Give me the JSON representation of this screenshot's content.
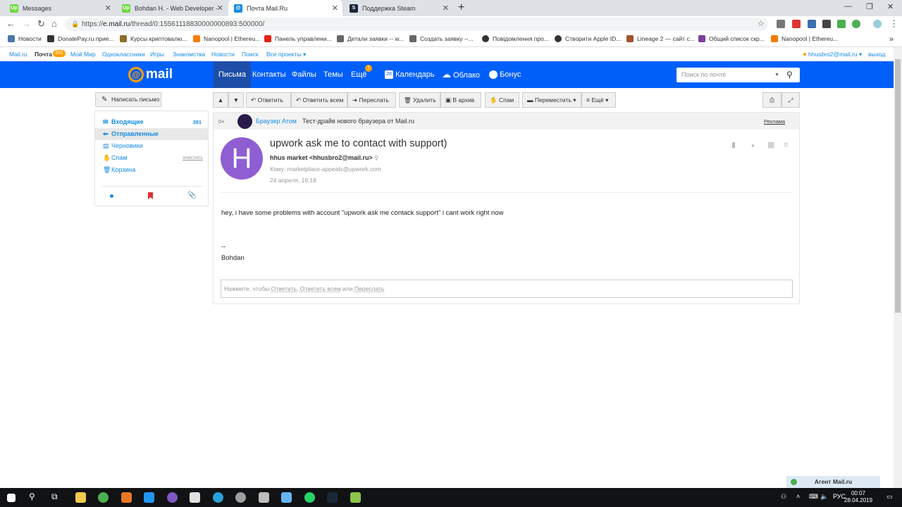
{
  "browser": {
    "tabs": [
      {
        "title": "Messages",
        "favicon": "upwork-icon",
        "color": "#6fda44"
      },
      {
        "title": "Bohdan H. - Web Developer - Up",
        "favicon": "upwork-icon",
        "color": "#6fda44"
      },
      {
        "title": "Почта Mail.Ru",
        "favicon": "mailru-icon",
        "color": "#168de2"
      },
      {
        "title": "Поддержка Steam",
        "favicon": "steam-icon",
        "color": "#1b2838"
      }
    ],
    "new_tab": "+",
    "url_prefix": "https://",
    "url_host": "e.mail.ru",
    "url_path": "/thread/0:15561118830000000893:500000/",
    "bookmarks": [
      {
        "label": "Новости",
        "color": "#4a76a8"
      },
      {
        "label": "DonatePay.ru прие...",
        "color": "#333"
      },
      {
        "label": "Курсы криптовалю...",
        "color": "#8b6d2d"
      },
      {
        "label": "Nanopool | Ethereu...",
        "color": "#f57c00"
      },
      {
        "label": "Панель управлени...",
        "color": "#e62117"
      },
      {
        "label": "Детали заявки -- w...",
        "color": "#555"
      },
      {
        "label": "Создать заявку --...",
        "color": "#555"
      },
      {
        "label": "Повідомлення про...",
        "color": "#333"
      },
      {
        "label": "Створити Apple ID...",
        "color": "#333"
      },
      {
        "label": "Lineage 2 — сайт с...",
        "color": "#a0522d"
      },
      {
        "label": "Общий список скр...",
        "color": "#7b3fa0"
      },
      {
        "label": "Nanopool | Ethereu...",
        "color": "#f57c00"
      }
    ]
  },
  "portal": {
    "links": [
      "Mail.ru",
      "Почта",
      "Мой Мир",
      "Одноклассники",
      "Игры",
      "Знакомства",
      "Новости",
      "Поиск",
      "Все проекты ▾"
    ],
    "pochta_count": "391",
    "user": "hhusbro2@mail.ru ▾",
    "logout": "выход"
  },
  "header": {
    "logo_text": "mail",
    "nav": [
      "Письма",
      "Контакты",
      "Файлы",
      "Темы",
      "Ещё"
    ],
    "more_badge": "1",
    "services": [
      "Календарь",
      "Облако",
      "Бонус"
    ],
    "calendar_day": "28",
    "search_placeholder": "Поиск по почте"
  },
  "sidebar": {
    "compose": "Написать письмо",
    "folders": [
      {
        "label": "Входящие",
        "count": "391"
      },
      {
        "label": "Отправленные"
      },
      {
        "label": "Черновики"
      },
      {
        "label": "Спам",
        "action": "очистить"
      },
      {
        "label": "Корзина"
      }
    ]
  },
  "toolbar": {
    "reply": "Ответить",
    "reply_all": "Ответить всем",
    "forward": "Переслать",
    "delete": "Удалить",
    "archive": "В архив",
    "spam": "Спам",
    "move": "Переместить ▾",
    "more": "≡ Ещё ▾"
  },
  "ad": {
    "age": "0+",
    "brand": "Браузер Атом",
    "text": "Тест-драйв нового браузера от Mail.ru",
    "label": "Реклама"
  },
  "message": {
    "avatar_letter": "H",
    "avatar_color": "#8f5ed2",
    "subject": "upwork ask me to contact with support)",
    "from": "hhus market <hhusbro2@mail.ru>",
    "to_label": "Кому:",
    "to": "marketplace-appeals@upwork.com",
    "date": "24 апреля, 16:18",
    "body_line1": "hey, i have some problems with account \"upwork ask me contack support\" i cant work right now",
    "signature_sep": "--",
    "signature": "Bohdan",
    "reply_prefix": "Нажмите, чтобы",
    "reply_link1": "Ответить",
    "reply_link2": "Ответить всем",
    "reply_or": "или",
    "reply_link3": "Переслать"
  },
  "agent": "Агент Mail.ru",
  "taskbar": {
    "time": "00:07",
    "date": "28.04.2019",
    "lang": "РУС"
  },
  "colors": {
    "header_blue": "#005ff9",
    "link_blue": "#168de2",
    "accent_orange": "#ff9e00"
  }
}
